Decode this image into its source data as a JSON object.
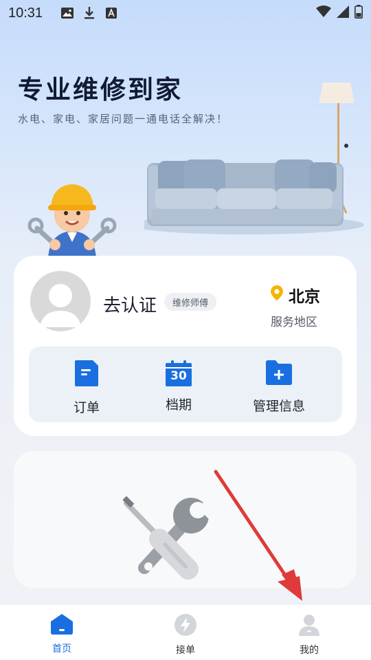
{
  "statusbar": {
    "time": "10:31"
  },
  "hero": {
    "title": "专业维修到家",
    "subtitle": "水电、家电、家居问题一通电话全解决！"
  },
  "profile": {
    "auth_label": "去认证",
    "role_badge": "维修师傅",
    "city": "北京",
    "city_label": "服务地区"
  },
  "quick_actions": [
    {
      "label": "订单",
      "icon": "document-icon"
    },
    {
      "label": "档期",
      "icon": "calendar-icon",
      "icon_text": "30"
    },
    {
      "label": "管理信息",
      "icon": "folder-add-icon"
    }
  ],
  "bottom_nav": [
    {
      "label": "首页",
      "icon": "home-icon",
      "active": true
    },
    {
      "label": "接单",
      "icon": "lightning-icon",
      "active": false
    },
    {
      "label": "我的",
      "icon": "user-icon",
      "active": false
    }
  ],
  "colors": {
    "accent": "#1a6fe0",
    "location_pin": "#f5b400",
    "arrow": "#e03a3a",
    "inactive_icon": "#d2d5da"
  }
}
